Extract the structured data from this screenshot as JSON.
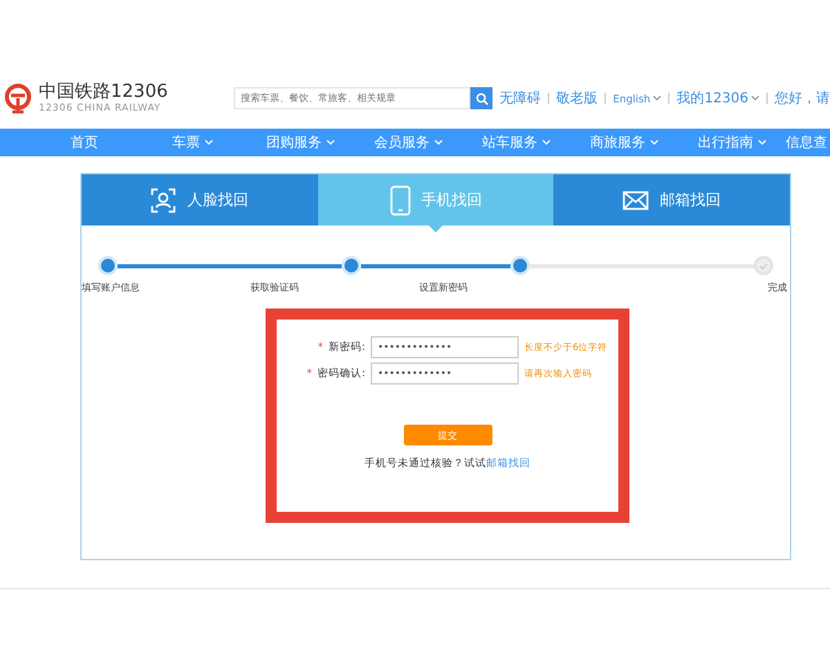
{
  "header": {
    "logo_title": "中国铁路12306",
    "logo_subtitle": "12306 CHINA RAILWAY",
    "search": {
      "placeholder": "搜索车票、餐饮、常旅客、相关规章"
    },
    "links": [
      {
        "label": "无障碍",
        "dropdown": false
      },
      {
        "label": "敬老版",
        "dropdown": false
      },
      {
        "label": "English",
        "dropdown": true
      },
      {
        "label": "我的12306",
        "dropdown": true
      },
      {
        "label": "您好，请",
        "dropdown": false
      }
    ]
  },
  "nav": [
    {
      "label": "首页",
      "dropdown": false
    },
    {
      "label": "车票",
      "dropdown": true
    },
    {
      "label": "团购服务",
      "dropdown": true
    },
    {
      "label": "会员服务",
      "dropdown": true
    },
    {
      "label": "站车服务",
      "dropdown": true
    },
    {
      "label": "商旅服务",
      "dropdown": true
    },
    {
      "label": "出行指南",
      "dropdown": true
    },
    {
      "label": "信息查",
      "dropdown": false
    }
  ],
  "tabs": [
    {
      "label": "人脸找回",
      "kind": "face",
      "selected": false
    },
    {
      "label": "手机找回",
      "kind": "phone",
      "selected": true
    },
    {
      "label": "邮箱找回",
      "kind": "mail",
      "selected": false
    }
  ],
  "steps": [
    {
      "label": "填写账户信息",
      "done": true
    },
    {
      "label": "获取验证码",
      "done": true
    },
    {
      "label": "设置新密码",
      "done": true
    },
    {
      "label": "完成",
      "done": false
    }
  ],
  "form": {
    "fields": [
      {
        "mark": "*",
        "label": "新密码:",
        "value": "•••••••••••••",
        "hint": "长度不少于6位字符"
      },
      {
        "mark": "*",
        "label": "密码确认:",
        "value": "•••••••••••••",
        "hint": "请再次输入密码"
      }
    ],
    "submit": "提交",
    "note": "手机号未通过核验？试试",
    "note_link": "邮箱找回"
  }
}
